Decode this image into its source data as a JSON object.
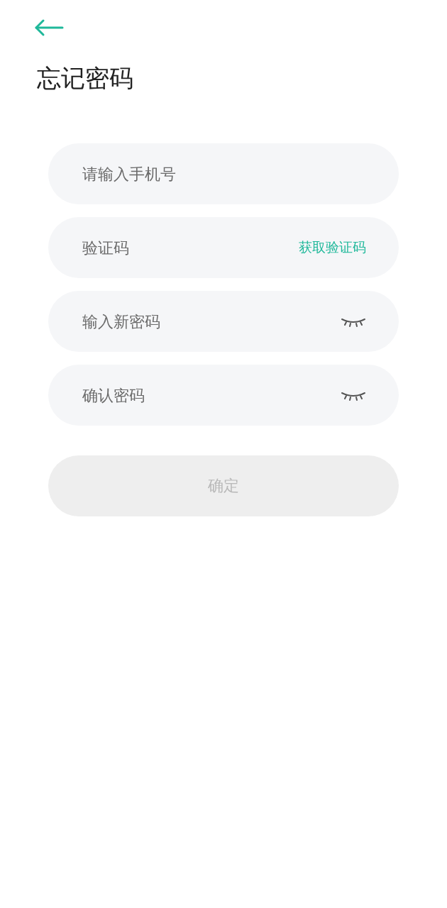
{
  "title": "忘记密码",
  "fields": [
    {
      "kind": "plain",
      "placeholder": "请输入手机号"
    },
    {
      "kind": "code",
      "placeholder": "验证码",
      "action": "获取验证码"
    },
    {
      "kind": "password",
      "placeholder": "输入新密码",
      "revealed": false
    },
    {
      "kind": "password",
      "placeholder": "确认密码",
      "revealed": false
    }
  ],
  "submit": {
    "label": "确定",
    "disabled": true
  }
}
